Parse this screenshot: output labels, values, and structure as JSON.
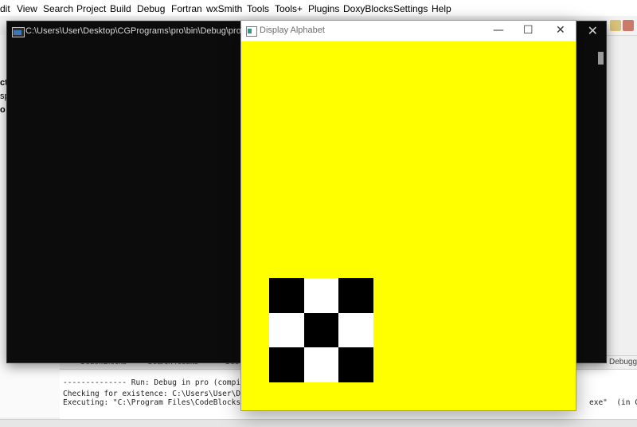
{
  "ide": {
    "menu": [
      "dit",
      "View",
      "Search",
      "Project",
      "Build",
      "Debug",
      "Fortran",
      "wxSmith",
      "Tools",
      "Tools+",
      "Plugins",
      "DoxyBlocks",
      "Settings",
      "Help"
    ],
    "left_panel": [
      "ct",
      "sp",
      "o"
    ],
    "logs_tabs": [
      "Code::Blocks",
      "Search results",
      "Coo",
      "Debugger"
    ],
    "log_lines": [
      "-------------- Run: Debug in pro (compil",
      "Checking for existence: C:\\Users\\User\\De",
      "Executing: \"C:\\Program Files\\CodeBlocks/"
    ],
    "log_tail": "exe\"  (in C:\\"
  },
  "console": {
    "title": "C:\\Users\\User\\Desktop\\CGPrograms\\pro\\bin\\Debug\\pro.exe",
    "close_glyph": "✕"
  },
  "display_window": {
    "title": "Display Alphabet",
    "minimize_glyph": "—",
    "maximize_glyph": "☐",
    "close_glyph": "✕",
    "background_color": "#ffff00",
    "checker_rows": [
      [
        "black",
        "white",
        "black"
      ],
      [
        "white",
        "black",
        "white"
      ],
      [
        "black",
        "white",
        "black"
      ]
    ]
  }
}
